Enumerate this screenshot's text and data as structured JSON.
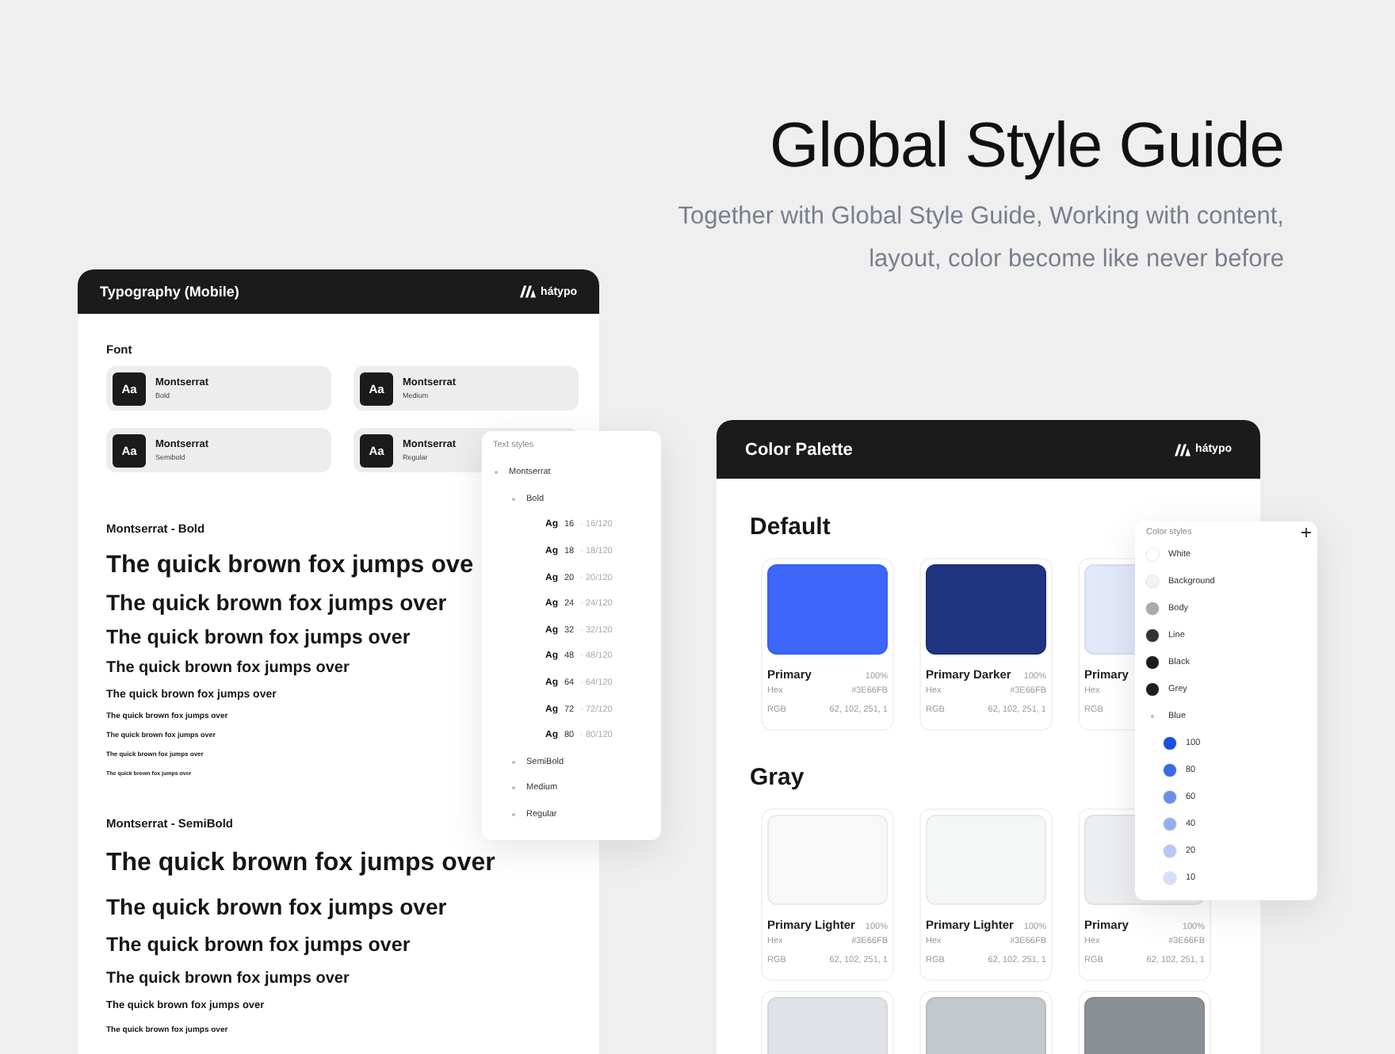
{
  "header": {
    "title": "Global Style Guide",
    "subtitle_lines": [
      "Together with Global Style Guide, Working with content,",
      "layout, color become like never before"
    ]
  },
  "typography_card": {
    "title": "Typography (Mobile)",
    "logo": "hátypo",
    "font_label": "Font",
    "fonts": [
      {
        "glyph": "Aa",
        "name": "Montserrat",
        "weight": "Bold"
      },
      {
        "glyph": "Aa",
        "name": "Montserrat",
        "weight": "Medium"
      },
      {
        "glyph": "Aa",
        "name": "Montserrat",
        "weight": "Semibold"
      },
      {
        "glyph": "Aa",
        "name": "Montserrat",
        "weight": "Regular"
      }
    ],
    "sections": [
      {
        "title": "Montserrat - Bold",
        "samples": [
          "The quick brown fox jumps ove",
          "The quick brown fox jumps over",
          "The quick brown fox jumps over",
          "The quick brown fox jumps over",
          "The quick brown fox jumps over",
          "The quick brown fox jumps over",
          "The quick brown fox jumps over",
          "The quick brown fox jumps over",
          "The quick brown fox jumps over"
        ]
      },
      {
        "title": "Montserrat - SemiBold",
        "samples": [
          "The quick brown fox jumps over",
          "The quick brown fox jumps over",
          "The quick brown fox jumps over",
          "The quick brown fox jumps over",
          "The quick brown fox jumps over",
          "The quick brown fox jumps over"
        ]
      }
    ]
  },
  "text_styles": {
    "title": "Text styles",
    "items": [
      {
        "kind": "group",
        "label": "Montserrat",
        "children": [
          {
            "kind": "group",
            "label": "Bold",
            "children": [
              {
                "kind": "style",
                "glyph": "Ag",
                "size": "16",
                "line": "· 16/120"
              },
              {
                "kind": "style",
                "glyph": "Ag",
                "size": "18",
                "line": "· 18/120"
              },
              {
                "kind": "style",
                "glyph": "Ag",
                "size": "20",
                "line": "· 20/120"
              },
              {
                "kind": "style",
                "glyph": "Ag",
                "size": "24",
                "line": "· 24/120"
              },
              {
                "kind": "style",
                "glyph": "Ag",
                "size": "32",
                "line": "· 32/120"
              },
              {
                "kind": "style",
                "glyph": "Ag",
                "size": "48",
                "line": "· 48/120"
              },
              {
                "kind": "style",
                "glyph": "Ag",
                "size": "64",
                "line": "· 64/120"
              },
              {
                "kind": "style",
                "glyph": "Ag",
                "size": "72",
                "line": "· 72/120"
              },
              {
                "kind": "style",
                "glyph": "Ag",
                "size": "80",
                "line": "· 80/120"
              }
            ]
          },
          {
            "kind": "group",
            "label": "SemiBold"
          },
          {
            "kind": "group",
            "label": "Medium"
          },
          {
            "kind": "group",
            "label": "Regular"
          }
        ]
      }
    ]
  },
  "color_card": {
    "title": "Color Palette",
    "logo": "hátypo",
    "groups": [
      {
        "title": "Default",
        "swatches": [
          {
            "color": "#3e66fb",
            "name": "Primary",
            "percent": "100%",
            "hex_label": "Hex",
            "hex": "#3E66FB",
            "rgb_label": "RGB",
            "rgb": "62, 102, 251, 1"
          },
          {
            "color": "#1f3380",
            "name": "Primary Darker",
            "percent": "100%",
            "hex_label": "Hex",
            "hex": "#3E66FB",
            "rgb_label": "RGB",
            "rgb": "62, 102, 251, 1"
          },
          {
            "color": "#e3e7fa",
            "name": "Primary",
            "hex_label": "Hex",
            "rgb_label": "RGB"
          }
        ]
      },
      {
        "title": "Gray",
        "swatches": [
          {
            "color": "#f8f8f8",
            "name": "Primary Lighter",
            "percent": "100%",
            "hex_label": "Hex",
            "hex": "#3E66FB",
            "rgb_label": "RGB",
            "rgb": "62, 102, 251, 1"
          },
          {
            "color": "#f5f6f6",
            "name": "Primary Lighter",
            "percent": "100%",
            "hex_label": "Hex",
            "hex": "#3E66FB",
            "rgb_label": "RGB",
            "rgb": "62, 102, 251, 1"
          },
          {
            "color": "#eceef0",
            "name": "Primary",
            "percent": "100%",
            "hex_label": "Hex",
            "hex": "#3E66FB",
            "rgb_label": "RGB",
            "rgb": "62, 102, 251, 1"
          },
          {
            "color": "#dfe2e6"
          },
          {
            "color": "#c3c8cf"
          },
          {
            "color": "#8a8f96"
          }
        ]
      }
    ]
  },
  "color_styles": {
    "title": "Color styles",
    "items": [
      {
        "kind": "color",
        "label": "White",
        "color": "#ffffff"
      },
      {
        "kind": "color",
        "label": "Background",
        "color": "#f2f2f2"
      },
      {
        "kind": "color",
        "label": "Body",
        "color": "#aaaaaa"
      },
      {
        "kind": "color",
        "label": "Line",
        "color": "#333333"
      },
      {
        "kind": "color",
        "label": "Black",
        "color": "#1c1c1c"
      },
      {
        "kind": "color",
        "label": "Grey",
        "color": "#202020"
      },
      {
        "kind": "group",
        "label": "Blue",
        "children": [
          {
            "kind": "color",
            "label": "100",
            "color": "#1a4fe0"
          },
          {
            "kind": "color",
            "label": "80",
            "color": "#3a6ae8"
          },
          {
            "kind": "color",
            "label": "60",
            "color": "#6b8fe9"
          },
          {
            "kind": "color",
            "label": "40",
            "color": "#97aeed"
          },
          {
            "kind": "color",
            "label": "20",
            "color": "#b8c7f3"
          },
          {
            "kind": "color",
            "label": "10",
            "color": "#d6dff8"
          }
        ]
      }
    ]
  }
}
